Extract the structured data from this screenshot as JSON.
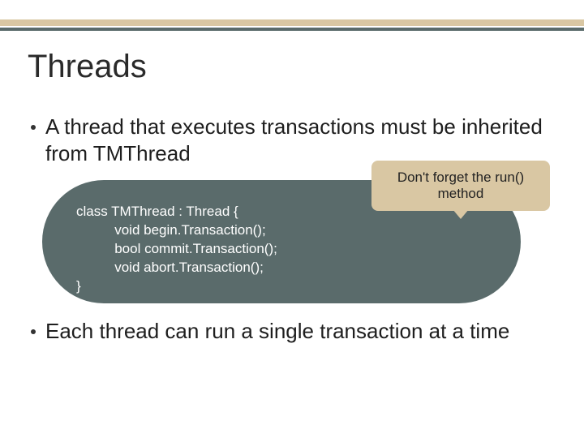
{
  "title": "Threads",
  "bullets": [
    "A thread that executes transactions must be inherited from TMThread",
    "Each thread can run a single transaction at a time"
  ],
  "callout": "Don't forget the run() method",
  "code": {
    "line1": "class TMThread : Thread {",
    "line2": "          void begin.Transaction();",
    "line3": "          bool commit.Transaction();",
    "line4": "          void abort.Transaction();",
    "line5": "}"
  }
}
